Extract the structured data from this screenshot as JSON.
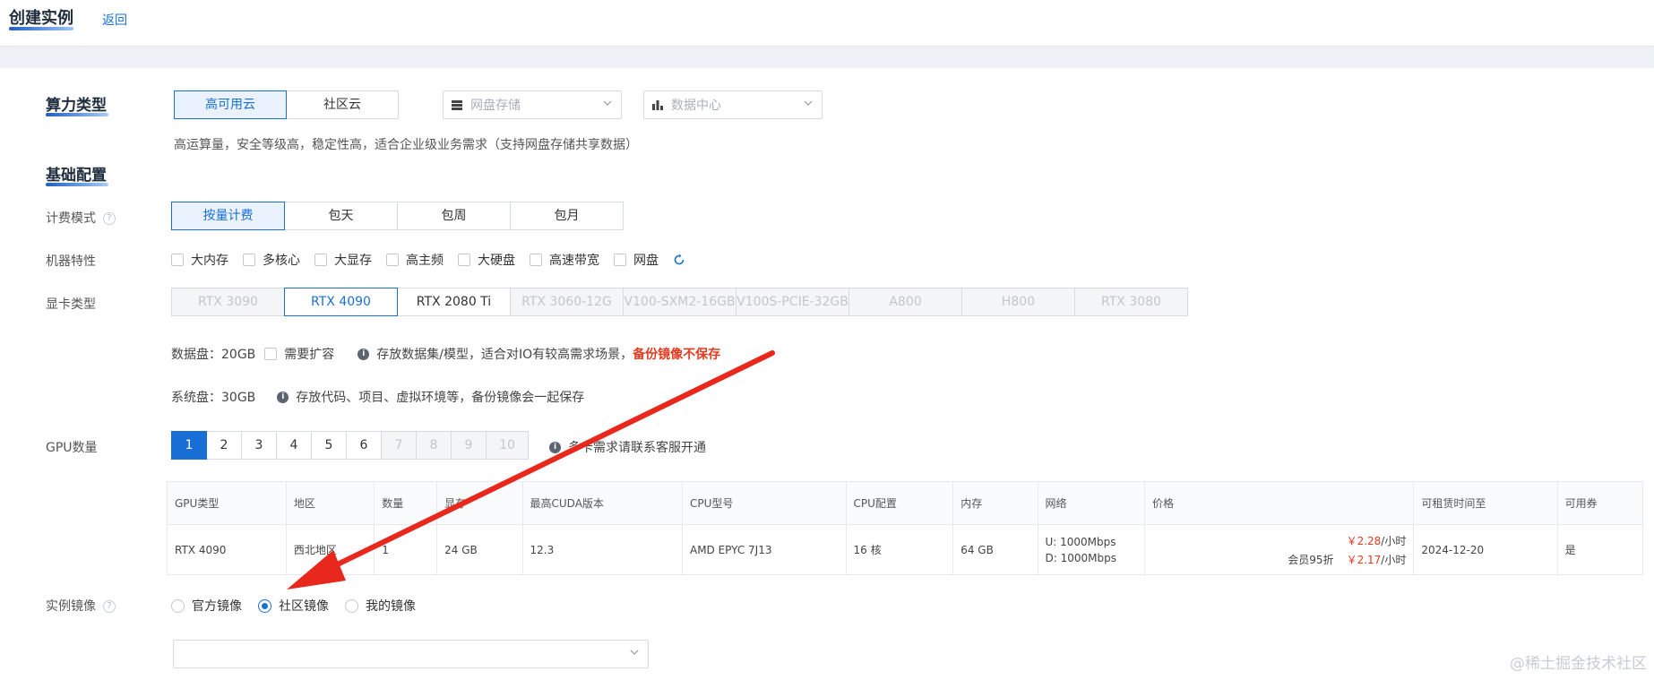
{
  "header": {
    "title": "创建实例",
    "back_label": "返回"
  },
  "compute_type": {
    "section_title": "算力类型",
    "options": [
      "高可用云",
      "社区云"
    ],
    "selected": "高可用云",
    "storage_placeholder": "网盘存储",
    "datacenter_placeholder": "数据中心",
    "description": "高运算量，安全等级高，稳定性高，适合企业级业务需求（支持网盘存储共享数据）"
  },
  "basic_config": {
    "section_title": "基础配置",
    "billing": {
      "label": "计费模式",
      "options": [
        "按量计费",
        "包天",
        "包周",
        "包月"
      ],
      "selected": "按量计费"
    },
    "features": {
      "label": "机器特性",
      "options": [
        "大内存",
        "多核心",
        "大显存",
        "高主频",
        "大硬盘",
        "高速带宽",
        "网盘"
      ]
    },
    "gpu_type": {
      "label": "显卡类型",
      "options": [
        {
          "name": "RTX 3090",
          "state": "disabled"
        },
        {
          "name": "RTX 4090",
          "state": "active"
        },
        {
          "name": "RTX 2080 Ti",
          "state": "normal"
        },
        {
          "name": "RTX 3060-12G",
          "state": "disabled"
        },
        {
          "name": "V100-SXM2-16GB",
          "state": "disabled"
        },
        {
          "name": "V100S-PCIE-32GB",
          "state": "disabled"
        },
        {
          "name": "A800",
          "state": "disabled"
        },
        {
          "name": "H800",
          "state": "disabled"
        },
        {
          "name": "RTX 3080",
          "state": "disabled"
        }
      ]
    },
    "data_disk": {
      "label": "数据盘：20GB",
      "expand_label": "需要扩容",
      "info": "存放数据集/模型，适合对IO有较高需求场景，",
      "warning": "备份镜像不保存"
    },
    "system_disk": {
      "label": "系统盘：30GB",
      "info": "存放代码、项目、虚拟环境等，备份镜像会一起保存"
    },
    "gpu_count": {
      "label": "GPU数量",
      "options": [
        {
          "n": "1",
          "state": "filled"
        },
        {
          "n": "2",
          "state": "normal"
        },
        {
          "n": "3",
          "state": "normal"
        },
        {
          "n": "4",
          "state": "normal"
        },
        {
          "n": "5",
          "state": "normal"
        },
        {
          "n": "6",
          "state": "normal"
        },
        {
          "n": "7",
          "state": "disabled"
        },
        {
          "n": "8",
          "state": "disabled"
        },
        {
          "n": "9",
          "state": "disabled"
        },
        {
          "n": "10",
          "state": "disabled"
        }
      ],
      "note": "多卡需求请联系客服开通"
    }
  },
  "spec_table": {
    "headers": [
      "GPU类型",
      "地区",
      "数量",
      "显存",
      "最高CUDA版本",
      "CPU型号",
      "CPU配置",
      "内存",
      "网络",
      "价格",
      "可租赁时间至",
      "可用券"
    ],
    "row": {
      "gpu": "RTX 4090",
      "region": "西北地区",
      "count": "1",
      "vram": "24 GB",
      "cuda": "12.3",
      "cpu_model": "AMD EPYC 7J13",
      "cpu_cores": "16 核",
      "memory": "64 GB",
      "net_up": "U: 1000Mbps",
      "net_down": "D: 1000Mbps",
      "price": "￥2.28",
      "price_unit": "/小时",
      "member_label": "会员95折",
      "member_price": "￥2.17",
      "member_unit": "/小时",
      "rent_until": "2024-12-20",
      "voucher": "是"
    }
  },
  "image": {
    "label": "实例镜像",
    "options": [
      "官方镜像",
      "社区镜像",
      "我的镜像"
    ],
    "selected": "社区镜像"
  },
  "watermark": "@稀土掘金技术社区",
  "colors": {
    "primary": "#1a6fd6",
    "warning": "#e33a1d",
    "arrow": "#e8281c"
  }
}
